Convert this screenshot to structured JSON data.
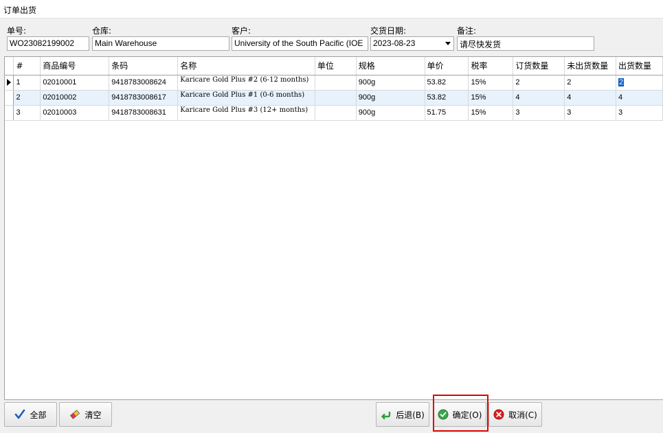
{
  "window": {
    "title": "订单出货"
  },
  "form": {
    "order_no": {
      "label": "单号:",
      "value": "WO23082199002"
    },
    "warehouse": {
      "label": "仓库:",
      "value": "Main Warehouse"
    },
    "customer": {
      "label": "客户:",
      "value": "University of the South Pacific (IOE"
    },
    "delivery_date": {
      "label": "交货日期:",
      "value": "2023-08-23"
    },
    "remark": {
      "label": "备注:",
      "value": "请尽快发货"
    }
  },
  "grid": {
    "columns": [
      "#",
      "商品编号",
      "条码",
      "名称",
      "单位",
      "规格",
      "单价",
      "税率",
      "订货数量",
      "未出货数量",
      "出货数量"
    ],
    "rows": [
      {
        "num": "1",
        "code": "02010001",
        "barcode": "9418783008624",
        "name": "Karicare Gold Plus #2 (6-12 months)",
        "unit": "",
        "spec": "900g",
        "price": "53.82",
        "tax": "15%",
        "ordered": "2",
        "pending": "2",
        "ship": "2"
      },
      {
        "num": "2",
        "code": "02010002",
        "barcode": "9418783008617",
        "name": "Karicare Gold Plus #1 (0-6 months)",
        "unit": "",
        "spec": "900g",
        "price": "53.82",
        "tax": "15%",
        "ordered": "4",
        "pending": "4",
        "ship": "4"
      },
      {
        "num": "3",
        "code": "02010003",
        "barcode": "9418783008631",
        "name": "Karicare Gold Plus #3 (12+ months)",
        "unit": "",
        "spec": "900g",
        "price": "51.75",
        "tax": "15%",
        "ordered": "3",
        "pending": "3",
        "ship": "3"
      }
    ]
  },
  "buttons": {
    "all": "全部",
    "clear": "清空",
    "back": "后退(B)",
    "confirm": "确定(O)",
    "cancel": "取消(C)"
  },
  "colors": {
    "highlight": "#e00000",
    "row_alt": "#e8f2fd",
    "selection": "#0a5ac8"
  }
}
